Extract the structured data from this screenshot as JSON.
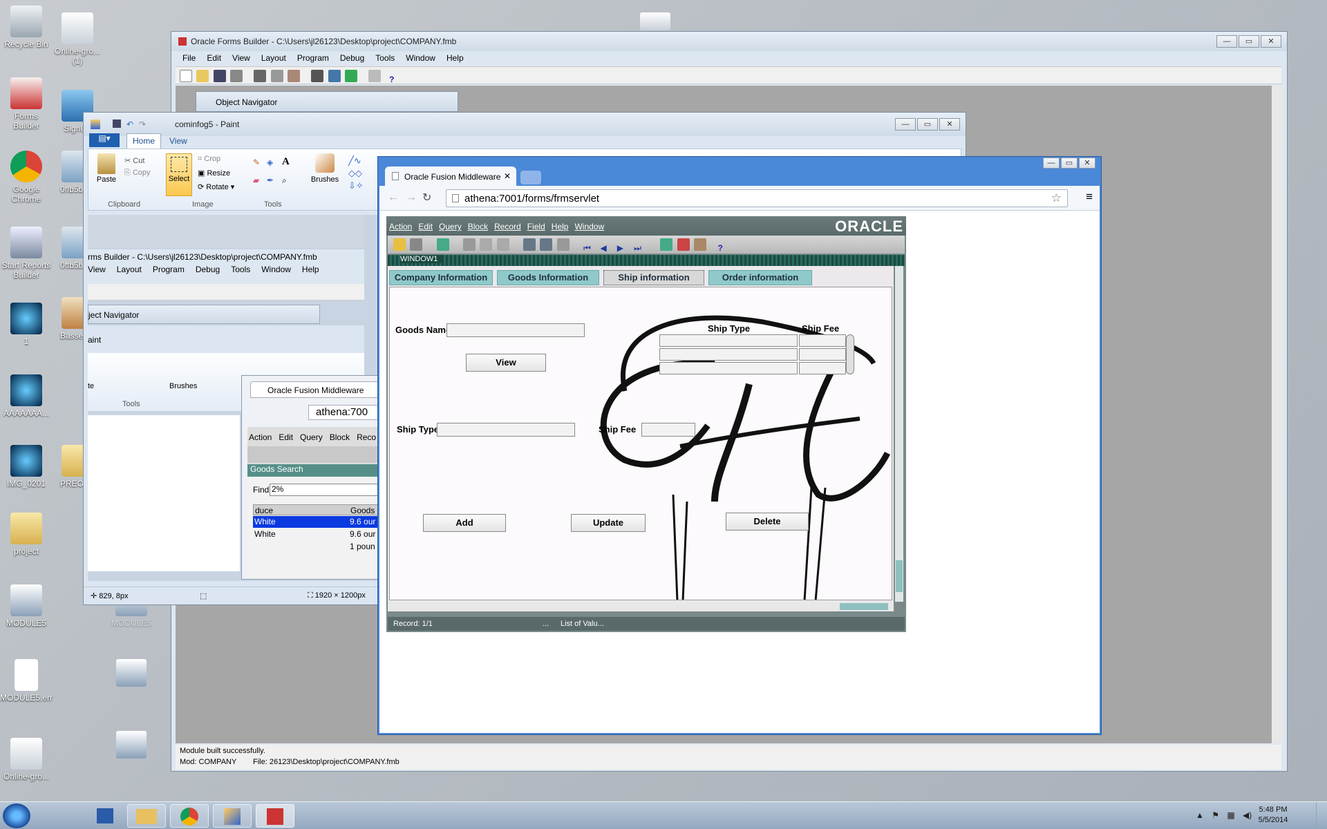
{
  "desktop": {
    "icons": [
      {
        "label": "Recycle Bin"
      },
      {
        "label": "Online-gro...\n(1)"
      },
      {
        "label": "Forms\nBuilder"
      },
      {
        "label": "SignUp"
      },
      {
        "label": "Google\nChrome"
      },
      {
        "label": "0ffb5b6..."
      },
      {
        "label": "Start Reports\nBuilder"
      },
      {
        "label": "0ffb5b6..."
      },
      {
        "label": "1"
      },
      {
        "label": "Bassett..."
      },
      {
        "label": "AAAAAAA..."
      },
      {
        "label": "IMG_0201"
      },
      {
        "label": "PREOJ..."
      },
      {
        "label": "project"
      },
      {
        "label": "MODULE5"
      },
      {
        "label": "MODULE5"
      },
      {
        "label": "MODULE5.err"
      },
      {
        "label": "Online-gro..."
      }
    ]
  },
  "forms_builder": {
    "title": "Oracle Forms Builder - C:\\Users\\jl26123\\Desktop\\project\\COMPANY.fmb",
    "menu": [
      "File",
      "Edit",
      "View",
      "Layout",
      "Program",
      "Debug",
      "Tools",
      "Window",
      "Help"
    ],
    "object_navigator": "Object Navigator",
    "status_line": "Module built successfully.",
    "status_mod": "Mod: COMPANY",
    "status_file": "File: 26123\\Desktop\\project\\COMPANY.fmb"
  },
  "paint": {
    "title": "cominfog5 - Paint",
    "tabs": [
      "Home",
      "View"
    ],
    "clipboard": {
      "paste": "Paste",
      "cut": "Cut",
      "copy": "Copy",
      "group": "Clipboard"
    },
    "image": {
      "select": "Select",
      "crop": "Crop",
      "resize": "Resize",
      "rotate": "Rotate",
      "group": "Image"
    },
    "tools_group": "Tools",
    "brushes": "Brushes",
    "status_pos": "829, 8px",
    "status_size": "1920 × 1200px",
    "inner": {
      "fb_title": "rms Builder - C:\\Users\\jl26123\\Desktop\\project\\COMPANY.fmb",
      "menu": [
        "View",
        "Layout",
        "Program",
        "Debug",
        "Tools",
        "Window",
        "Help"
      ],
      "obj_nav": "ject Navigator",
      "paint_label": "aint",
      "brushes": "Brushes",
      "tools_group": "Tools",
      "te_label": "te",
      "chrome_tab": "Oracle Fusion Middleware",
      "url": "athena:700",
      "menu2": [
        "Action",
        "Edit",
        "Query",
        "Block",
        "Reco"
      ],
      "goods_search": "Goods Search",
      "find_label": "Find",
      "find_value": "2%",
      "col1": "duce",
      "col2": "Goods",
      "rows": [
        {
          "c1": "White",
          "c2": "9.6 our"
        },
        {
          "c1": "White",
          "c2": "9.6 our"
        },
        {
          "c1": "",
          "c2": "1 poun"
        }
      ]
    }
  },
  "chrome": {
    "tab_title": "Oracle Fusion Middleware",
    "url": "athena:7001/forms/frmservlet"
  },
  "oracle_form": {
    "menu": [
      "Action",
      "Edit",
      "Query",
      "Block",
      "Record",
      "Field",
      "Help",
      "Window"
    ],
    "logo": "ORACLE",
    "window_title": "WINDOW1",
    "tabs": [
      "Company Information",
      "Goods Information",
      "Ship information",
      "Order information"
    ],
    "active_tab": "Ship information",
    "goods_name_label": "Goods Name",
    "goods_name_value": "",
    "view_button": "View",
    "grid_headers": [
      "Ship Type",
      "Ship Fee"
    ],
    "ship_type_label": "Ship Type",
    "ship_fee_label": "Ship Fee",
    "add_button": "Add",
    "update_button": "Update",
    "delete_button": "Delete",
    "status_record": "Record: 1/1",
    "status_dots": "...",
    "status_lov": "List of Valu..."
  },
  "taskbar": {
    "time": "5:48 PM",
    "date": "5/5/2014"
  }
}
